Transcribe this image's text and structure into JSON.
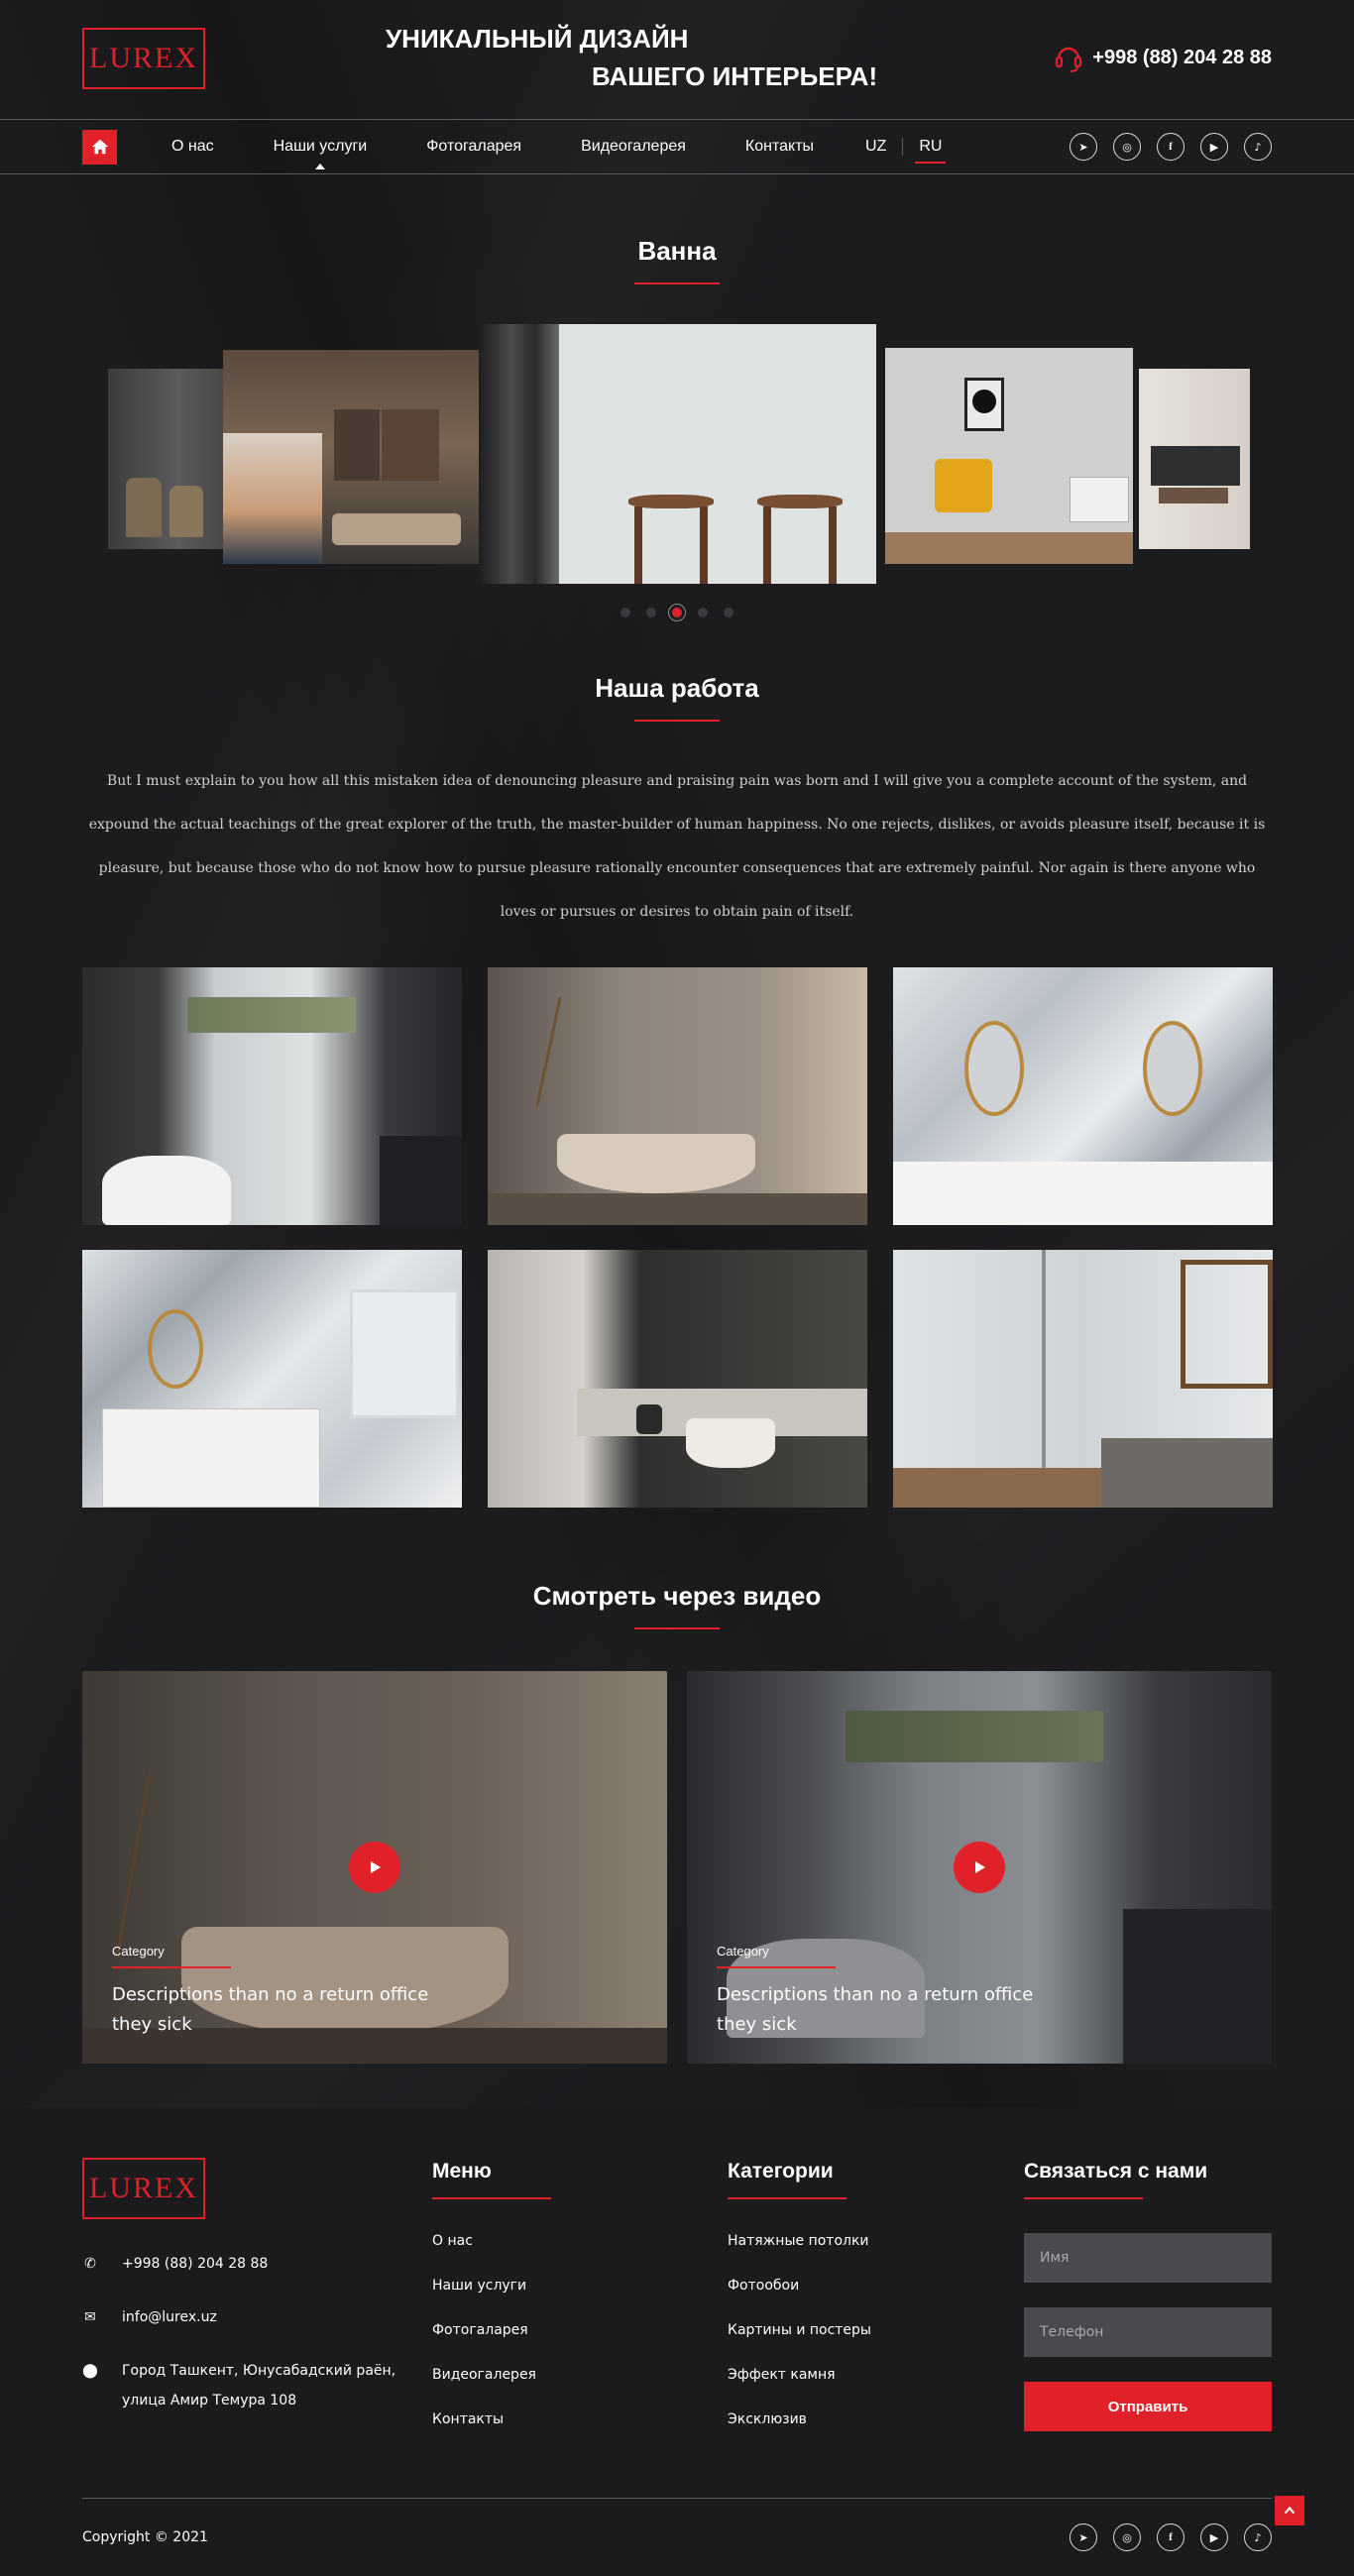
{
  "brand": {
    "logo_text": "LUREX"
  },
  "header": {
    "tagline_line1": "УНИКАЛЬНЫЙ ДИЗАЙН",
    "tagline_line2": "ВАШЕГО ИНТЕРЬЕРА!",
    "phone": "+998 (88) 204 28 88"
  },
  "nav": {
    "items": [
      {
        "label": "О нас",
        "active": false
      },
      {
        "label": "Наши услуги",
        "active": true
      },
      {
        "label": "Фотогаларея",
        "active": false
      },
      {
        "label": "Видеогалерея",
        "active": false
      },
      {
        "label": "Контакты",
        "active": false
      }
    ],
    "lang_uz": "UZ",
    "lang_ru": "RU",
    "socials": [
      "telegram-icon",
      "instagram-icon",
      "facebook-icon",
      "youtube-icon",
      "tiktok-icon"
    ]
  },
  "carousel": {
    "title": "Ванна",
    "active_index": 2,
    "dot_count": 5
  },
  "work": {
    "title": "Наша работа",
    "text": "But I must explain to you how all this mistaken idea of denouncing pleasure and praising pain was born and I will give you a complete account of the system, and expound the actual teachings of the great explorer of the truth, the master-builder of human happiness. No one rejects, dislikes, or avoids pleasure itself, because it is pleasure, but because those who do not know how to pursue pleasure rationally encounter consequences that are extremely painful. Nor again is there anyone who loves or pursues or desires to obtain pain of itself."
  },
  "video": {
    "title": "Смотреть через видео",
    "cards": [
      {
        "category": "Category",
        "description": "Descriptions than no a return office they sick"
      },
      {
        "category": "Category",
        "description": "Descriptions than no a return office they sick"
      }
    ]
  },
  "footer": {
    "phone": "+998 (88) 204 28 88",
    "email": "info@lurex.uz",
    "address_line1": "Город Ташкент, Юнусабадский раён,",
    "address_line2": "улица Амир Темура 108",
    "menu_title": "Меню",
    "menu": [
      "О нас",
      "Наши услуги",
      "Фотогаларея",
      "Видеогалерея",
      "Контакты"
    ],
    "categories_title": "Категории",
    "categories": [
      "Натяжные потолки",
      "Фотообои",
      "Картины и постеры",
      "Эффект камня",
      "Эксклюзив"
    ],
    "contact_title": "Связаться с нами",
    "name_placeholder": "Имя",
    "phone_placeholder": "Телефон",
    "send_label": "Отправить",
    "copyright": "Copyright © 2021"
  },
  "colors": {
    "accent": "#e0212a",
    "background": "#1c1c1f",
    "field": "#4a4a4e"
  }
}
